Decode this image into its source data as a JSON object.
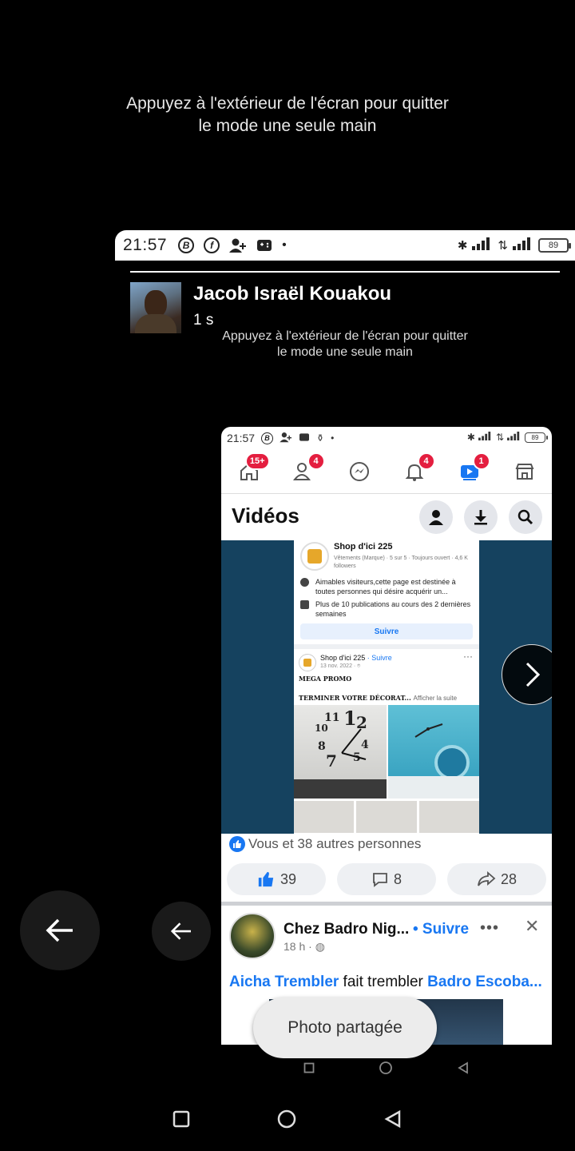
{
  "one_hand_hint": {
    "line1": "Appuyez à l'extérieur de l'écran pour quitter",
    "line2": "le mode une seule main"
  },
  "outer_status": {
    "time": "21:57",
    "battery": "89"
  },
  "poster": {
    "name": "Jacob Israël Kouakou",
    "time": "1 s"
  },
  "inner_status": {
    "time": "21:57",
    "battery": "89"
  },
  "fb_nav": {
    "home_badge": "15+",
    "friends_badge": "4",
    "notifications_badge": "4",
    "video_badge": "1"
  },
  "videos": {
    "title": "Vidéos"
  },
  "video_card": {
    "page_name": "Shop d'ici 225",
    "page_meta": "Vêtements (Marque) · 5 sur 5 · Toujours ouvert · 4,6 K followers",
    "info1": "Aimables visiteurs,cette page est destinée à toutes personnes qui désire acquérir un...",
    "info2": "Plus de 10 publications au cours des 2 dernières semaines",
    "follow_label": "Suivre",
    "post_name": "Shop d'ici 225",
    "post_follow": "· Suivre",
    "post_date": "13 nov. 2022 · ⌾",
    "promo": "MEGA PROMO",
    "deco": "TERMINER VOTRE DÉCORAT...",
    "more": "Afficher la suite"
  },
  "reactions": {
    "text": "Vous et 38 autres personnes"
  },
  "actions": {
    "likes": "39",
    "comments": "8",
    "shares": "28"
  },
  "post2": {
    "page_name": "Chez Badro Nig...",
    "follow": "• Suivre",
    "time": "18 h ·",
    "tag1": "Aicha Trembler",
    "verb": " fait trembler ",
    "tag2": "Badro Escoba..."
  },
  "toast": {
    "text": "Photo partagée"
  },
  "colors": {
    "facebook_blue": "#1877f2",
    "badge_red": "#e41e3f",
    "video_bg": "#15425f"
  }
}
